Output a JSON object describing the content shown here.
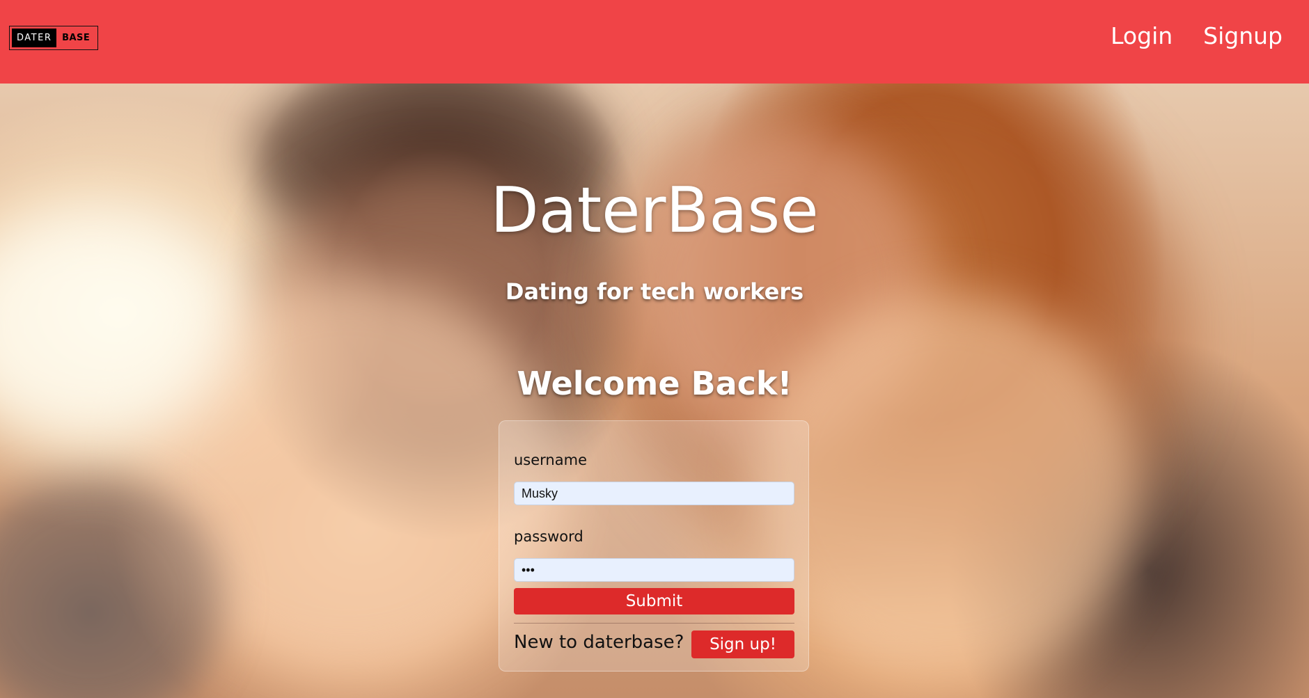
{
  "navbar": {
    "logo_left": "DATER",
    "logo_right": "BASE",
    "links": [
      "Login",
      "Signup"
    ],
    "background_color": "#f04447"
  },
  "hero": {
    "title": "DaterBase",
    "subtitle": "Dating for tech workers",
    "welcome": "Welcome Back!"
  },
  "login_form": {
    "username_label": "username",
    "username_value": "Musky",
    "password_label": "password",
    "password_value": "abc",
    "submit_label": "Submit",
    "new_user_text": "New to daterbase?",
    "signup_label": "Sign up!",
    "button_color": "#dd2a2a"
  }
}
